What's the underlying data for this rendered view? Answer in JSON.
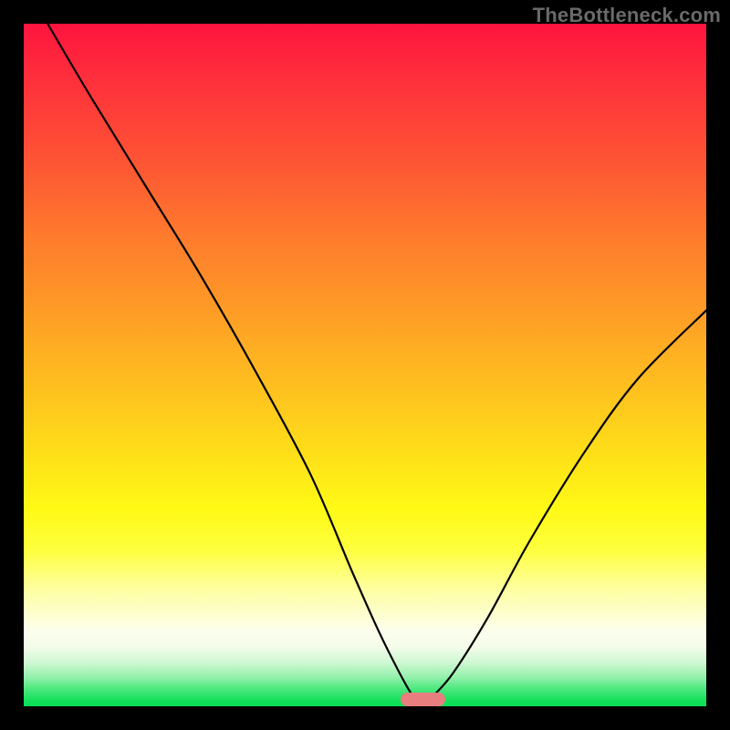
{
  "watermark": "TheBottleneck.com",
  "chart_data": {
    "type": "line",
    "title": "",
    "xlabel": "",
    "ylabel": "",
    "xlim": [
      0,
      100
    ],
    "ylim": [
      0,
      100
    ],
    "grid": false,
    "legend": false,
    "series": [
      {
        "name": "curve",
        "x": [
          3.5,
          10,
          18,
          26,
          34,
          42,
          48,
          52,
          55,
          57,
          58.5,
          60,
          63,
          68,
          74,
          82,
          90,
          100
        ],
        "y": [
          100,
          89,
          76,
          63,
          49,
          34,
          20,
          11,
          5,
          1.5,
          0,
          1.5,
          5,
          13,
          24,
          37,
          48,
          58
        ]
      }
    ],
    "marker": {
      "x_center": 58.5,
      "width": 6.5,
      "height": 2.0
    },
    "gradient_colors": {
      "top": "#fe143e",
      "mid": "#fff915",
      "bottom": "#0cdf55"
    },
    "curve_color": "#000000"
  }
}
